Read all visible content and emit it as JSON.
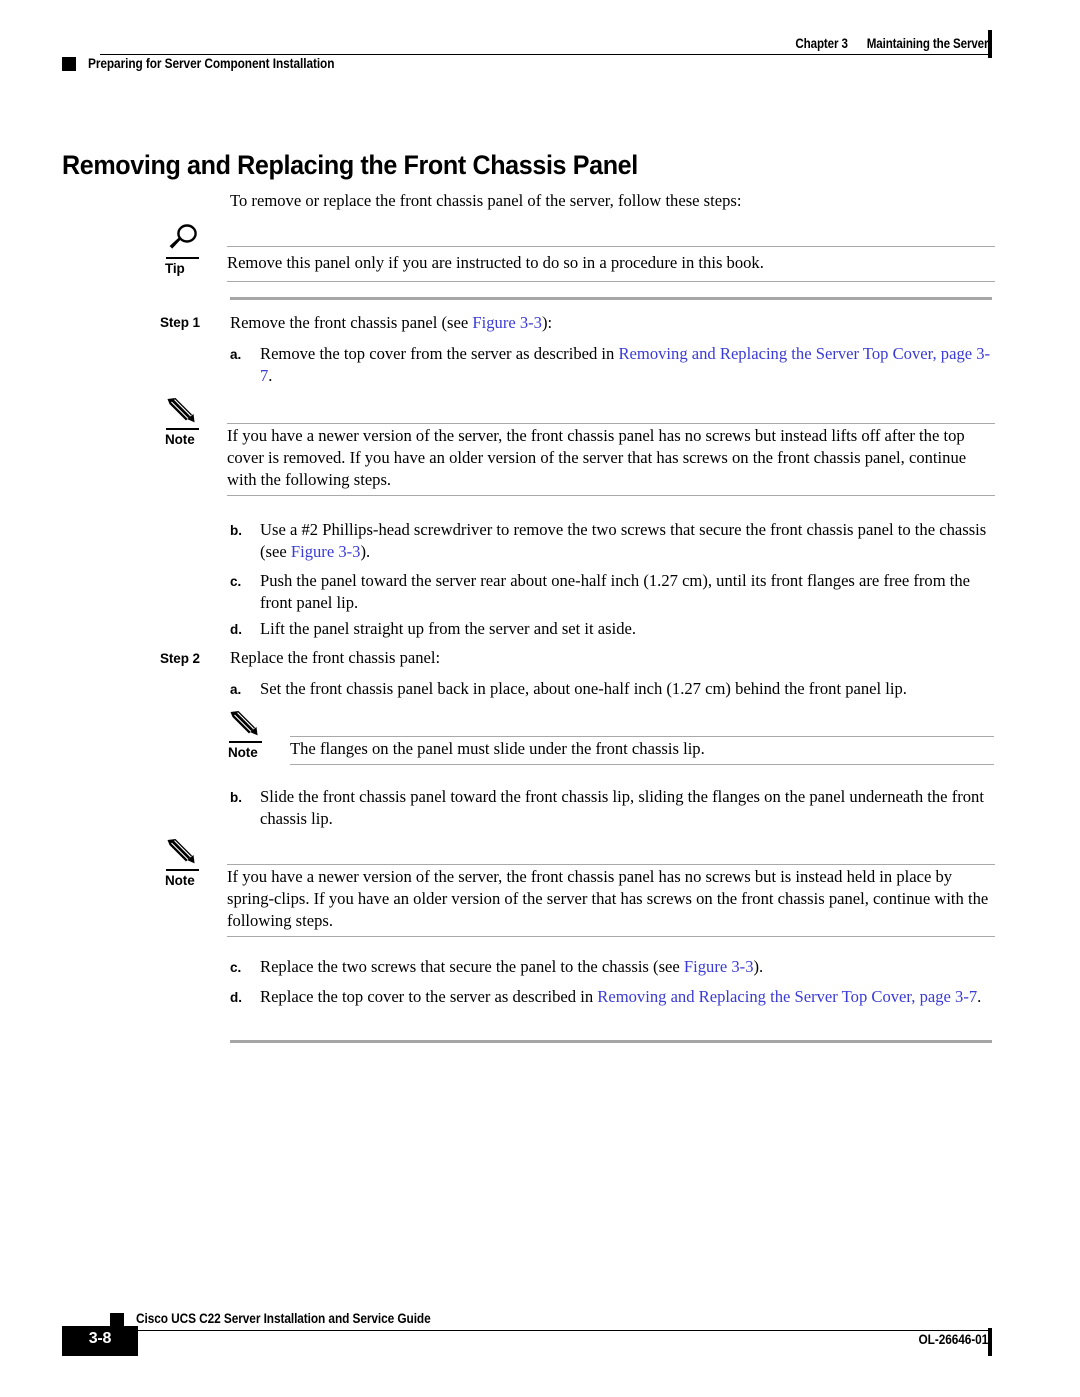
{
  "header": {
    "chapter_num": "Chapter 3",
    "chapter_title": "Maintaining the Server",
    "running_head": "Preparing for Server Component Installation"
  },
  "title": "Removing and Replacing the Front Chassis Panel",
  "intro": "To remove or replace the front chassis panel of the server, follow these steps:",
  "tip": {
    "label": "Tip",
    "icon": "magnifier-icon",
    "text": "Remove this panel only if you are instructed to do so in a procedure in this book."
  },
  "steps": [
    {
      "label": "Step 1",
      "text_pre": "Remove the front chassis panel (see ",
      "link": "Figure 3-3",
      "text_post": "):"
    },
    {
      "label": "Step 2",
      "text_pre": "Replace the front chassis panel:",
      "link": "",
      "text_post": ""
    }
  ],
  "step1_substeps": {
    "a_marker": "a.",
    "a_text_pre": "Remove the top cover from the server as described in ",
    "a_link": "Removing and Replacing the Server Top Cover, page 3-7",
    "a_text_post": ".",
    "b_marker": "b.",
    "b_text_pre": "Use a #2 Phillips-head screwdriver to remove the two screws that secure the front chassis panel to the chassis (see ",
    "b_link": "Figure 3-3",
    "b_text_post": ").",
    "c_marker": "c.",
    "c_text": "Push the panel toward the server rear about one-half inch (1.27 cm), until its front flanges are free from the front panel lip.",
    "d_marker": "d.",
    "d_text": "Lift the panel straight up from the server and set it aside."
  },
  "note1": {
    "label": "Note",
    "icon": "pencil-icon",
    "text": "If you have a newer version of the server, the front chassis panel has no screws but instead lifts off after the top cover is removed. If you have an older version of the server that has screws on the front chassis panel, continue with the following steps."
  },
  "step2_substeps": {
    "a_marker": "a.",
    "a_text": "Set the front chassis panel back in place, about one-half inch (1.27 cm) behind the front panel lip.",
    "b_marker": "b.",
    "b_text": "Slide the front chassis panel toward the front chassis lip, sliding the flanges on the panel underneath the front chassis lip.",
    "c_marker": "c.",
    "c_text_pre": "Replace the two screws that secure the panel to the chassis (see ",
    "c_link": "Figure 3-3",
    "c_text_post": ").",
    "d_marker": "d.",
    "d_text_pre": "Replace the top cover to the server as described in ",
    "d_link": "Removing and Replacing the Server Top Cover, page 3-7",
    "d_text_post": "."
  },
  "note2": {
    "label": "Note",
    "icon": "pencil-icon",
    "text": "The flanges on the panel must slide under the front chassis lip."
  },
  "note3": {
    "label": "Note",
    "icon": "pencil-icon",
    "text": "If you have a newer version of the server, the front chassis panel has no screws but is instead held in place by spring-clips. If you have an older version of the server that has screws on the front chassis panel, continue with the following steps."
  },
  "footer": {
    "guide_title": "Cisco UCS C22 Server Installation and Service Guide",
    "page_number": "3-8",
    "doc_id": "OL-26646-01"
  },
  "colors": {
    "link": "#3A3AD6",
    "rule_gray": "#a9a9a9",
    "rule_gray_thick": "#a6a6a6",
    "black": "#000000"
  }
}
